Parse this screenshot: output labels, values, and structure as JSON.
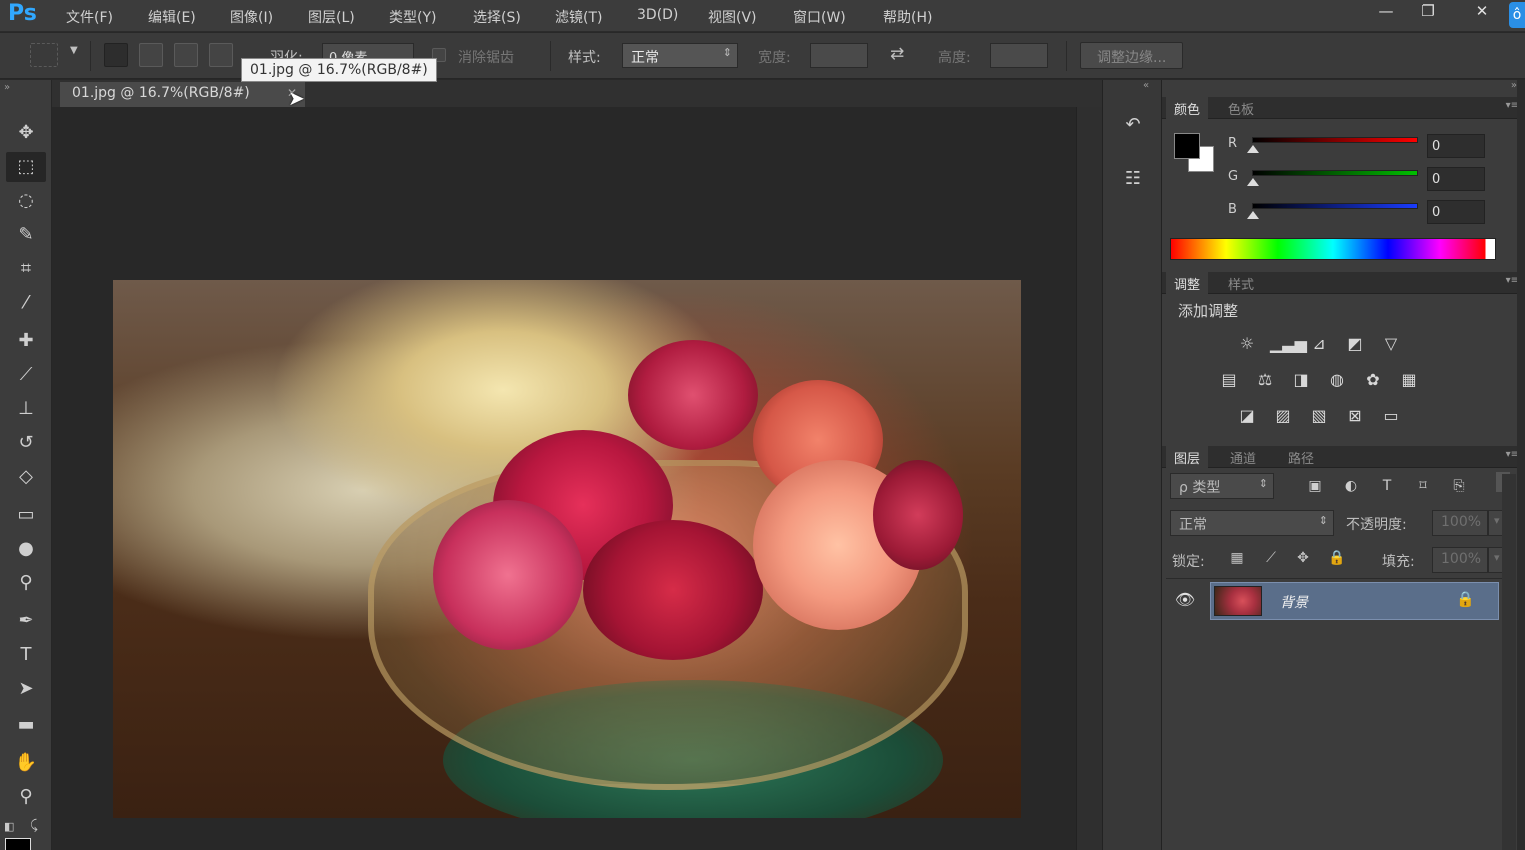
{
  "app": {
    "logo": "Ps"
  },
  "menu": [
    "文件(F)",
    "编辑(E)",
    "图像(I)",
    "图层(L)",
    "类型(Y)",
    "选择(S)",
    "滤镜(T)",
    "3D(D)",
    "视图(V)",
    "窗口(W)",
    "帮助(H)"
  ],
  "window_controls": {
    "minimize": "—",
    "restore": "❐",
    "close": "✕"
  },
  "options": {
    "feather_label": "羽化:",
    "feather_value": "0 像素",
    "antialias_label": "消除锯齿",
    "style_label": "样式:",
    "style_value": "正常",
    "width_label": "宽度:",
    "height_label": "高度:",
    "refine_edge": "调整边缘..."
  },
  "tooltip": "01.jpg @ 16.7%(RGB/8#)",
  "document": {
    "tab_title": "01.jpg @ 16.7%(RGB/8#)",
    "close": "✕"
  },
  "tools": [
    "move-tool",
    "marquee-tool",
    "lasso-tool",
    "quick-select-tool",
    "crop-tool",
    "eyedropper-tool",
    "healing-tool",
    "brush-tool",
    "stamp-tool",
    "history-brush-tool",
    "eraser-tool",
    "gradient-tool",
    "blur-tool",
    "dodge-tool",
    "pen-tool",
    "type-tool",
    "path-select-tool",
    "rectangle-tool",
    "hand-tool",
    "zoom-tool"
  ],
  "color_panel": {
    "tabs": [
      "颜色",
      "色板"
    ],
    "r_label": "R",
    "g_label": "G",
    "b_label": "B",
    "r": "0",
    "g": "0",
    "b": "0",
    "foreground": "#000000",
    "background": "#ffffff"
  },
  "adjustments_panel": {
    "tabs": [
      "调整",
      "样式"
    ],
    "title": "添加调整"
  },
  "layers_panel": {
    "tabs": [
      "图层",
      "通道",
      "路径"
    ],
    "filter_type": "ρ 类型",
    "blend_mode": "正常",
    "opacity_label": "不透明度:",
    "opacity_value": "100%",
    "lock_label": "锁定:",
    "fill_label": "填充:",
    "fill_value": "100%",
    "layers": [
      {
        "name": "背景",
        "visible": true,
        "locked": true
      }
    ]
  }
}
